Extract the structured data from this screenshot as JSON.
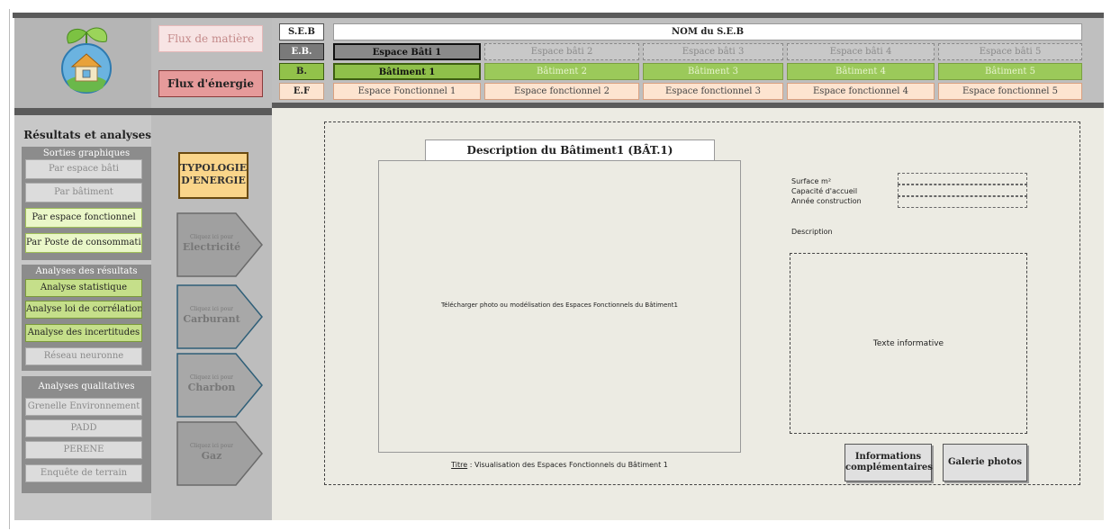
{
  "logo": {
    "icon": "eco-house-icon"
  },
  "left": {
    "title": "Résultats et analyses",
    "groups": [
      {
        "title": "Sorties graphiques",
        "items": [
          "Par espace bâti",
          "Par bâtiment",
          "Par espace fonctionnel",
          "Par Poste de consommation"
        ]
      },
      {
        "title": "Analyses des résultats",
        "items": [
          "Analyse statistique",
          "Analyse loi de corrélation",
          "Analyse des incertitudes",
          "Réseau neuronne"
        ]
      },
      {
        "title": "Analyses qualitatives",
        "items": [
          "Grenelle Environnement",
          "PADD",
          "PERENE",
          "Enquête de terrain"
        ]
      }
    ]
  },
  "flux": {
    "matiere": "Flux de matière",
    "energie": "Flux d'énergie"
  },
  "typologie": {
    "line1": "TYPOLOGIE",
    "line2": "D'ENERGIE"
  },
  "energies": [
    {
      "hint": "Cliquez ici pour",
      "label": "Electricité"
    },
    {
      "hint": "Cliquez ici pour",
      "label": "Carburant"
    },
    {
      "hint": "Cliquez ici pour",
      "label": "Charbon"
    },
    {
      "hint": "Cliquez ici pour",
      "label": "Gaz"
    }
  ],
  "header": {
    "row_labels": [
      "S.E.B",
      "E.B.",
      "B.",
      "E.F"
    ],
    "nom": "NOM du S.E.B",
    "espaces_batis": [
      "Espace Bâti 1",
      "Espace bâti 2",
      "Espace bâti 3",
      "Espace bâti 4",
      "Espace bâti 5"
    ],
    "batiments": [
      "Bâtiment 1",
      "Bâtiment 2",
      "Bâtiment 3",
      "Bâtiment 4",
      "Bâtiment 5"
    ],
    "espaces_fonctionnels": [
      "Espace Fonctionnel 1",
      "Espace fonctionnel 2",
      "Espace fonctionnel 3",
      "Espace fonctionnel 4",
      "Espace fonctionnel 5"
    ]
  },
  "main": {
    "title": "Description du Bâtiment1 (BÂT.1)",
    "photo_placeholder": "Télécharger photo ou modélisation des Espaces Fonctionnels du Bâtiment1",
    "caption_prefix": "Titre",
    "caption_text": " : Visualisation des Espaces Fonctionnels du Bâtiment 1",
    "fields": [
      "Surface m²",
      "Capacité d'accueil",
      "Année construction"
    ],
    "description_label": "Description",
    "text_box": "Texte informative",
    "btn_info_line1": "Informations",
    "btn_info_line2": "complémentaires",
    "btn_gallery": "Galerie photos"
  }
}
